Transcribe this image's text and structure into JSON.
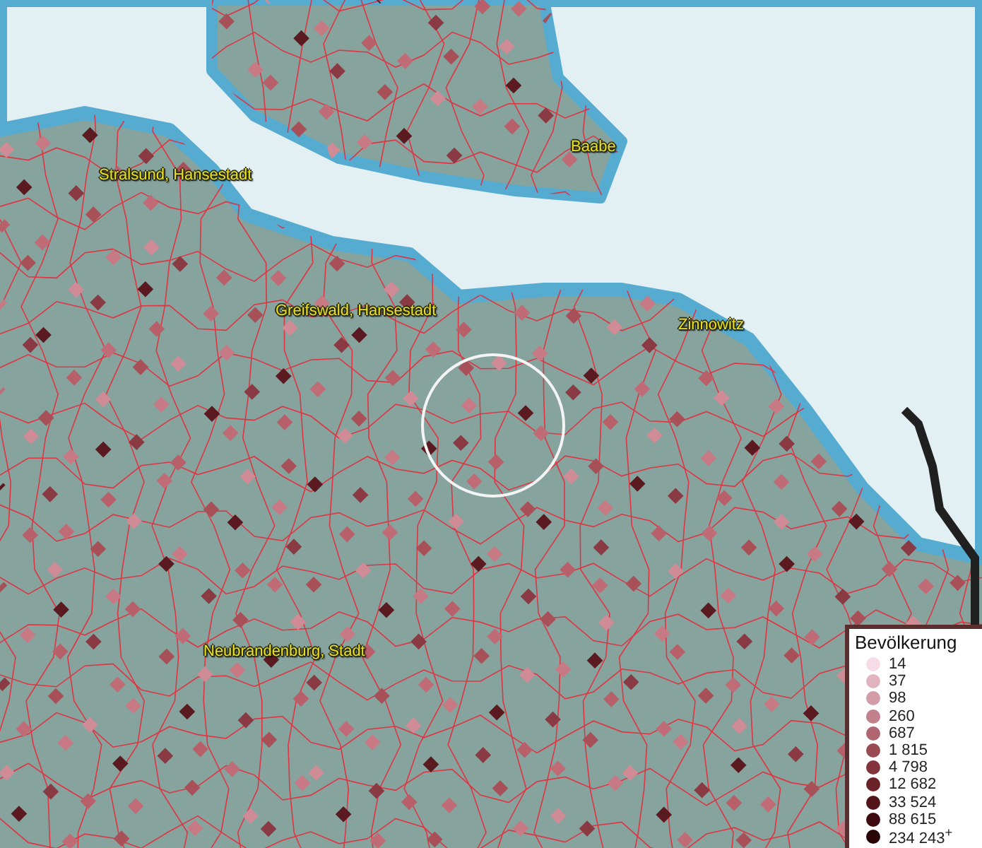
{
  "map": {
    "place_labels": [
      {
        "text": "Stralsund, Hansestadt"
      },
      {
        "text": "Baabe"
      },
      {
        "text": "Greifswald, Hansestadt"
      },
      {
        "text": "Zinnowitz"
      },
      {
        "text": "Neubrandenburg, Stadt"
      }
    ]
  },
  "legend": {
    "title": "Bevölkerung",
    "items": [
      {
        "label": "14",
        "color": "#f5dce6"
      },
      {
        "label": "37",
        "color": "#e2b4c0"
      },
      {
        "label": "98",
        "color": "#d29ca8"
      },
      {
        "label": "260",
        "color": "#c2808c"
      },
      {
        "label": "687",
        "color": "#b06670"
      },
      {
        "label": "1 815",
        "color": "#9a4a52"
      },
      {
        "label": "4 798",
        "color": "#82343c"
      },
      {
        "label": "12 682",
        "color": "#6a2228"
      },
      {
        "label": "33 524",
        "color": "#52141a"
      },
      {
        "label": "88 615",
        "color": "#3c0a10"
      },
      {
        "label": "234 243$^{+}$",
        "color": "#2a0508"
      }
    ]
  }
}
